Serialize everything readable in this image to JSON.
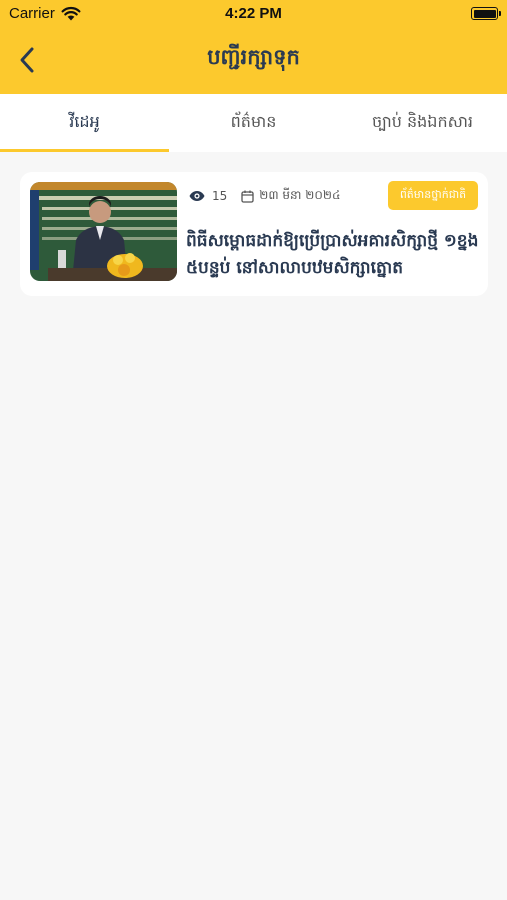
{
  "status_bar": {
    "carrier": "Carrier",
    "time": "4:22 PM"
  },
  "header": {
    "title": "បញ្ជីរក្សាទុក",
    "back_icon": "chevron-left-icon"
  },
  "tabs": [
    {
      "label": "វីដេអូ",
      "active": true
    },
    {
      "label": "ព័ត៌មាន",
      "active": false
    },
    {
      "label": "ច្បាប់ និងឯកសារ",
      "active": false
    }
  ],
  "colors": {
    "accent": "#fcc92d",
    "title_text": "#2a3a52",
    "background": "#f7f7f7"
  },
  "items": [
    {
      "views": "15",
      "date": "២៣ មីនា ២០២៤",
      "category": "ព័ត៌មានថ្នាក់ជាតិ",
      "title": "ពិធីសម្ពោធដាក់ឱ្យប្រើប្រាស់អគារសិក្សាថ្មី ១ខ្នង ៥បន្ទប់ នៅសាលាបឋមសិក្សាត្នោត",
      "view_icon": "eye-icon",
      "date_icon": "calendar-icon"
    }
  ]
}
